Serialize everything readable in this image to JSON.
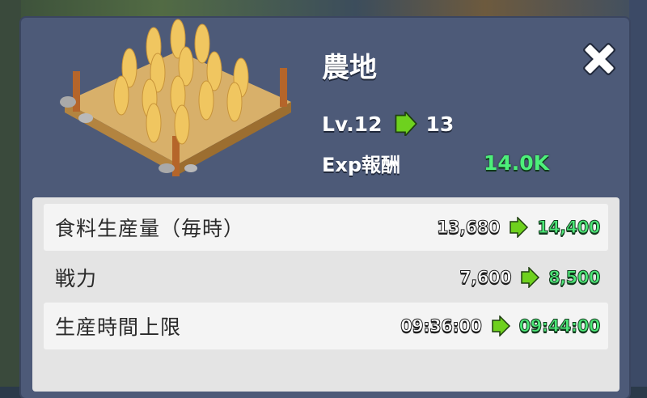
{
  "building": {
    "name": "農地",
    "level_current": "Lv.12",
    "level_next": "13",
    "exp_label": "Exp報酬",
    "exp_value": "14.0K"
  },
  "stats": [
    {
      "label": "食料生産量（毎時）",
      "current": "13,680",
      "next": "14,400"
    },
    {
      "label": "戦力",
      "current": "7,600",
      "next": "8,500"
    },
    {
      "label": "生産時間上限",
      "current": "09:36:00",
      "next": "09:44:00"
    }
  ],
  "icons": {
    "close": "close-icon",
    "arrow": "arrow-right-icon",
    "building": "wheat-farm-icon"
  },
  "colors": {
    "panel": "#4d5a78",
    "new_value": "#4de878",
    "arrow": "#6ed11e"
  }
}
